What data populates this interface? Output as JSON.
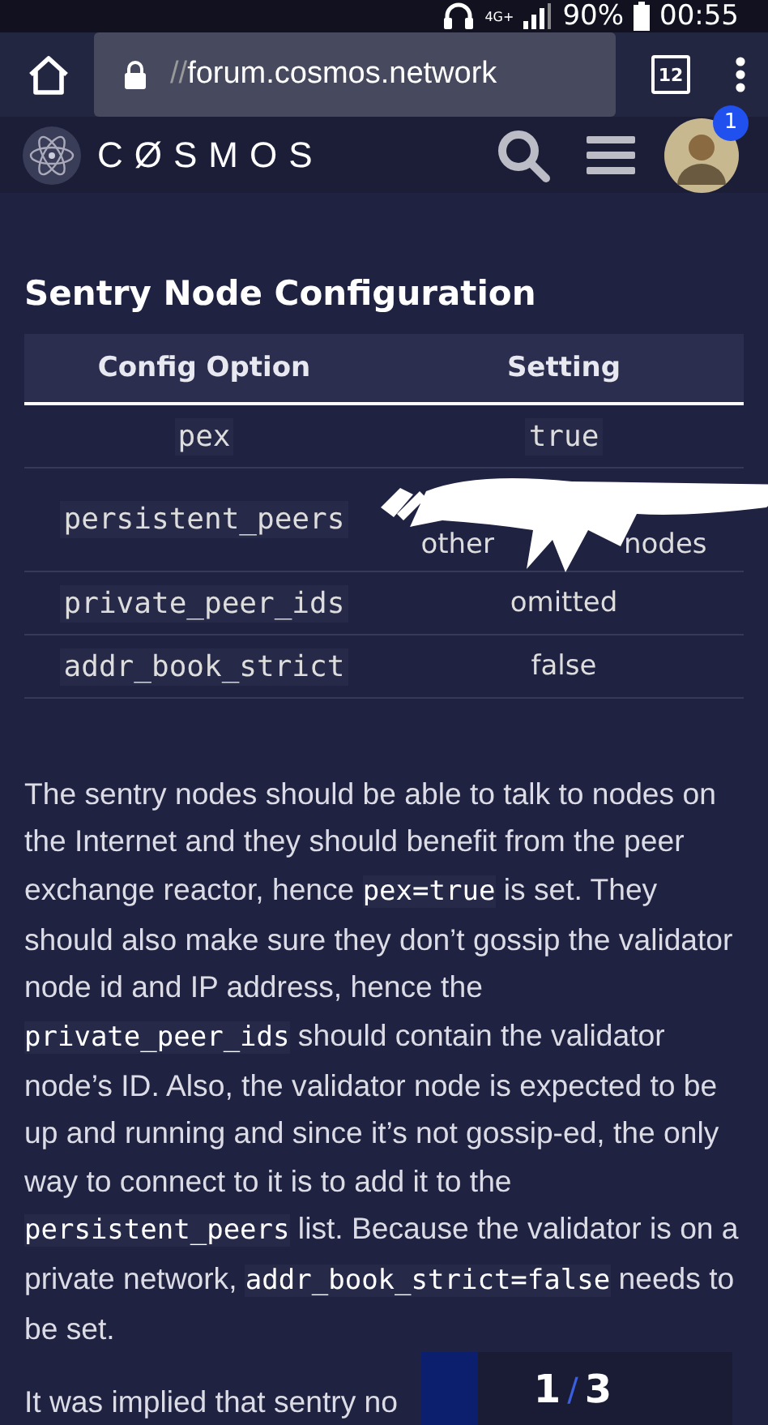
{
  "status_bar": {
    "battery": "90%",
    "time": "00:55",
    "network": "4G+"
  },
  "browser": {
    "url_prefix": "//",
    "url": "forum.cosmos.network",
    "tab_count": "12"
  },
  "site_header": {
    "logo": "CØSMOS",
    "notification_count": "1"
  },
  "post": {
    "heading": "Sentry Node Configuration",
    "table": {
      "columns": [
        "Config Option",
        "Setting"
      ],
      "rows": [
        {
          "option": "pex",
          "setting": [
            "true"
          ],
          "setting_code": true,
          "scribbled": false
        },
        {
          "option": "persistent_peers",
          "setting": [
            "other",
            "nodes"
          ],
          "setting_code": false,
          "scribbled": true
        },
        {
          "option": "private_peer_ids",
          "setting": [
            "omitted"
          ],
          "setting_code": false,
          "scribbled": false
        },
        {
          "option": "addr_book_strict",
          "setting": [
            "false"
          ],
          "setting_code": false,
          "scribbled": false
        }
      ]
    },
    "paragraphs": [
      [
        {
          "text": "The sentry nodes should be able to talk to nodes on the Internet and they should benefit from the peer exchange reactor, hence ",
          "code": false
        },
        {
          "text": "pex=true",
          "code": true
        },
        {
          "text": " is set. They should also make sure they don’t gossip the validator node id and IP address, hence the ",
          "code": false
        },
        {
          "text": "private_peer_ids",
          "code": true
        },
        {
          "text": " should contain the validator node’s ID. Also, the validator node is expected to be up and running and since it’s not gossip-ed, the only way to connect to it is to add it to the ",
          "code": false
        },
        {
          "text": "persistent_peers",
          "code": true
        },
        {
          "text": " list. Because the validator is on a private network, ",
          "code": false
        },
        {
          "text": "addr_book_strict=false",
          "code": true
        },
        {
          "text": " needs to be set.",
          "code": false
        }
      ],
      [
        {
          "text": "It was implied that sentry no",
          "code": false
        }
      ]
    ]
  },
  "progress": {
    "current": "1",
    "separator": "/",
    "total": "3"
  }
}
